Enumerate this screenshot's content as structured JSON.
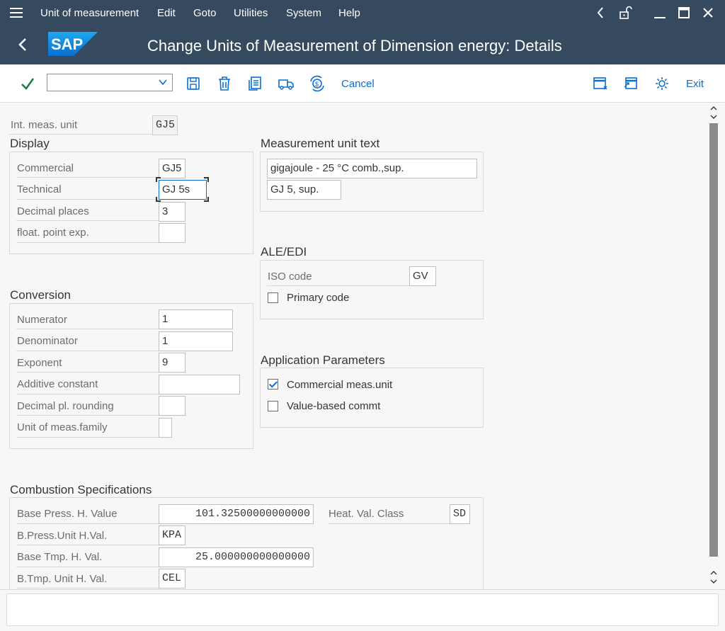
{
  "menu": {
    "items": [
      {
        "label": "Unit of measurement"
      },
      {
        "label": "Edit"
      },
      {
        "label": "Goto"
      },
      {
        "label": "Utilities"
      },
      {
        "label": "System"
      },
      {
        "label": "Help"
      }
    ]
  },
  "header": {
    "logo_text": "SAP",
    "title": "Change Units of Measurement of Dimension energy: Details"
  },
  "toolbar": {
    "command_value": "",
    "cancel_label": "Cancel",
    "exit_label": "Exit"
  },
  "top": {
    "int_unit_label": "Int. meas. unit",
    "int_unit_value": "GJ5"
  },
  "display": {
    "title": "Display",
    "rows": [
      {
        "label": "Commercial",
        "value": "GJ5"
      },
      {
        "label": "Technical",
        "value": "GJ 5s"
      },
      {
        "label": "Decimal places",
        "value": "3"
      },
      {
        "label": "float. point exp.",
        "value": ""
      }
    ]
  },
  "unit_text": {
    "title": "Measurement unit text",
    "long_text": "gigajoule - 25 °C comb.,sup.",
    "short_text": "GJ 5, sup."
  },
  "ale": {
    "title": "ALE/EDI",
    "iso_label": "ISO code",
    "iso_value": "GV",
    "primary_label": "Primary code",
    "primary_checked": false
  },
  "conversion": {
    "title": "Conversion",
    "rows": [
      {
        "label": "Numerator",
        "value": "1"
      },
      {
        "label": "Denominator",
        "value": "1"
      },
      {
        "label": "Exponent",
        "value": "9"
      },
      {
        "label": "Additive constant",
        "value": ""
      },
      {
        "label": "Decimal pl. rounding",
        "value": ""
      },
      {
        "label": "Unit of meas.family",
        "value": ""
      }
    ]
  },
  "app_params": {
    "title": "Application Parameters",
    "commercial_label": "Commercial meas.unit",
    "commercial_checked": true,
    "value_based_label": "Value-based commt",
    "value_based_checked": false
  },
  "combustion": {
    "title": "Combustion Specifications",
    "base_press_label": "Base Press. H. Value",
    "base_press_value": "101.32500000000000",
    "heat_class_label": "Heat. Val. Class",
    "heat_class_value": "SD",
    "press_unit_label": "B.Press.Unit H.Val.",
    "press_unit_value": "KPA",
    "base_tmp_label": "Base Tmp. H. Val.",
    "base_tmp_value": "25.000000000000000",
    "tmp_unit_label": "B.Tmp. Unit H. Val.",
    "tmp_unit_value": "CEL"
  },
  "status": {
    "message": ""
  },
  "colors": {
    "shell": "#354a5f",
    "accent": "#0a6ed1",
    "check_green": "#107e3e"
  }
}
